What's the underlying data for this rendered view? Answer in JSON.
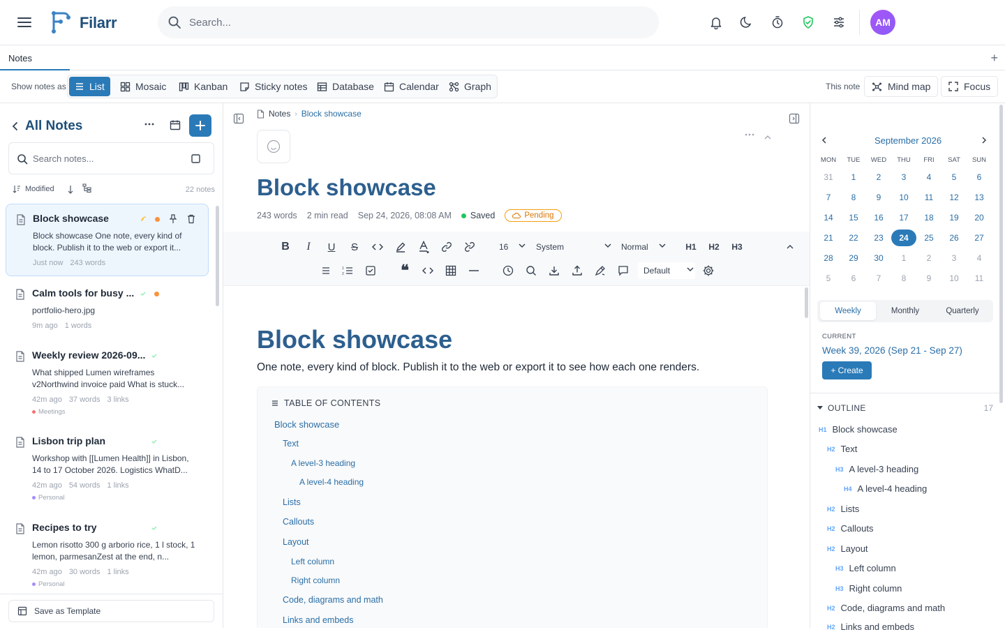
{
  "header": {
    "brand": "Filarr",
    "search_placeholder": "Search...",
    "avatar_initials": "AM",
    "accent_color": "#2a7ab8"
  },
  "tabs": {
    "active": "Notes"
  },
  "views": {
    "label": "Show notes as",
    "items": [
      "List",
      "Mosaic",
      "Kanban",
      "Sticky notes",
      "Database",
      "Calendar",
      "Graph"
    ],
    "active": "List",
    "this_note_label": "This note",
    "mind_map": "Mind map",
    "focus": "Focus"
  },
  "sidebar": {
    "title": "All Notes",
    "search_placeholder": "Search notes...",
    "sort_label": "Modified",
    "count": "22 notes",
    "notes": [
      {
        "title": "Block showcase",
        "preview": "Block showcase One note, every kind of block. Publish it to the web or export it...",
        "time": "Just now",
        "words": "243 words",
        "links": "",
        "tag": ""
      },
      {
        "title": "Calm tools for busy ...",
        "preview": "portfolio-hero.jpg",
        "time": "9m ago",
        "words": "1 words",
        "links": "",
        "tag": ""
      },
      {
        "title": "Weekly review 2026-09...",
        "preview": "What shipped Lumen wireframes v2Northwind invoice paid What is stuck...",
        "time": "42m ago",
        "words": "37 words",
        "links": "3 links",
        "tag": "Meetings"
      },
      {
        "title": "Lisbon trip plan",
        "preview": "Workshop with [[Lumen Health]] in Lisbon, 14 to 17 October 2026. Logistics WhatD...",
        "time": "42m ago",
        "words": "54 words",
        "links": "1 links",
        "tag": "Personal"
      },
      {
        "title": "Recipes to try",
        "preview": "Lemon risotto 300 g arborio rice, 1 l stock, 1 lemon, parmesanZest at the end, n...",
        "time": "42m ago",
        "words": "30 words",
        "links": "1 links",
        "tag": "Personal"
      }
    ],
    "save_template": "Save as Template"
  },
  "editor": {
    "breadcrumb": [
      "Notes",
      "Block showcase"
    ],
    "title": "Block showcase",
    "meta": {
      "words": "243 words",
      "read": "2 min read",
      "date": "Sep 24, 2026, 08:08 AM",
      "saved": "Saved",
      "status": "Pending"
    },
    "toolbar": {
      "font_size": "16",
      "font_family": "System",
      "block_style": "Normal",
      "h1": "H1",
      "h2": "H2",
      "h3": "H3",
      "theme": "Default"
    },
    "intro": "One note, every kind of block. Publish it to the web or export it to see how each one renders.",
    "toc_title": "TABLE OF CONTENTS",
    "toc": [
      "Block showcase",
      "Text",
      "A level-3 heading",
      "A level-4 heading",
      "Lists",
      "Callouts",
      "Layout",
      "Left column",
      "Right column",
      "Code, diagrams and math",
      "Links and embeds"
    ]
  },
  "calendar": {
    "month": "September 2026",
    "dows": [
      "MON",
      "TUE",
      "WED",
      "THU",
      "FRI",
      "SAT",
      "SUN"
    ],
    "days": [
      "31",
      "1",
      "2",
      "3",
      "4",
      "5",
      "6",
      "7",
      "8",
      "9",
      "10",
      "11",
      "12",
      "13",
      "14",
      "15",
      "16",
      "17",
      "18",
      "19",
      "20",
      "21",
      "22",
      "23",
      "24",
      "25",
      "26",
      "27",
      "28",
      "29",
      "30",
      "1",
      "2",
      "3",
      "4",
      "5",
      "6",
      "7",
      "8",
      "9",
      "10",
      "11"
    ],
    "today": "24",
    "periods": [
      "Weekly",
      "Monthly",
      "Quarterly"
    ],
    "active_period": "Weekly",
    "current_label": "CURRENT",
    "current_week": "Week 39, 2026 (Sep 21 - Sep 27)",
    "create": "+ Create"
  },
  "outline": {
    "title": "OUTLINE",
    "count": "17",
    "items": [
      {
        "level": "H1",
        "text": "Block showcase"
      },
      {
        "level": "H2",
        "text": "Text"
      },
      {
        "level": "H3",
        "text": "A level-3 heading"
      },
      {
        "level": "H4",
        "text": "A level-4 heading"
      },
      {
        "level": "H2",
        "text": "Lists"
      },
      {
        "level": "H2",
        "text": "Callouts"
      },
      {
        "level": "H2",
        "text": "Layout"
      },
      {
        "level": "H3",
        "text": "Left column"
      },
      {
        "level": "H3",
        "text": "Right column"
      },
      {
        "level": "H2",
        "text": "Code, diagrams and math"
      },
      {
        "level": "H2",
        "text": "Links and embeds"
      }
    ]
  }
}
